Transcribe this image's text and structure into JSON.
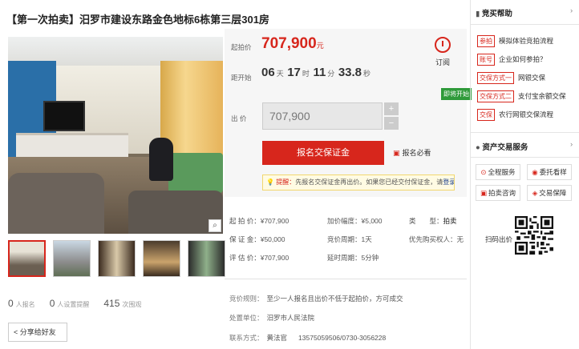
{
  "title": "【第一次拍卖】汨罗市建设东路金色地标6栋第三层301房",
  "price": {
    "start_label": "起拍价",
    "start_value": "707,900",
    "start_unit": "元",
    "countdown_label": "距开始",
    "days": "06",
    "days_unit": "天",
    "hours": "17",
    "hours_unit": "时",
    "minutes": "11",
    "minutes_unit": "分",
    "seconds": "33.8",
    "seconds_unit": "秒",
    "remind_label": "订阅",
    "status": "即将开始",
    "bid_label": "出 价",
    "bid_value": "707,900",
    "plus": "+",
    "minus": "−",
    "signup_button": "报名交保证金",
    "must_read": "报名必看",
    "notice_prefix": "提醒：",
    "notice_text": "先报名交保证金再出价。如果您已经交付保证金，请",
    "notice_link": "登录"
  },
  "details": {
    "start_price": "起 拍 价：¥707,900",
    "increment": "加价幅度：¥5,000",
    "type_label": "类　　型：",
    "type_value": "拍卖",
    "deposit": "保 证 金：¥50,000",
    "cycle": "竞价周期：1天",
    "priority": "优先购买权人：无",
    "assess": "评 估 价：¥707,900",
    "delay": "延时周期：5分钟"
  },
  "info": {
    "rule_label": "竞价规则：",
    "rule_value": "至少一人报名且出价不低于起拍价，方可成交",
    "unit_label": "处置单位：",
    "unit_value": "汨罗市人民法院",
    "contact_label": "联系方式：",
    "contact_name": "黄法官",
    "contact_phone": "13575059506/0730-3056228"
  },
  "stats": {
    "signups": "0",
    "signups_label": "人报名",
    "reminders": "0",
    "reminders_label": "人设置提醒",
    "views": "415",
    "views_label": "次围观"
  },
  "share_label": "分享给好友",
  "sidebar": {
    "help_title": "竞买帮助",
    "help_items": [
      {
        "tag": "参拍",
        "text": "模拟体验竞拍流程"
      },
      {
        "tag": "账号",
        "text": "企业如何参拍？"
      },
      {
        "tag": "交保方式一",
        "text": "网银交保"
      },
      {
        "tag": "交保方式二",
        "text": "支付宝余额交保"
      },
      {
        "tag": "交保",
        "text": "农行网银交保流程"
      }
    ],
    "service_title": "资产交易服务",
    "services": [
      "全程服务",
      "委托看样",
      "拍卖咨询",
      "交易保障"
    ],
    "qr_label": "扫码出价"
  },
  "colors": {
    "accent": "#d7261c",
    "status_green": "#2f9a3a"
  }
}
